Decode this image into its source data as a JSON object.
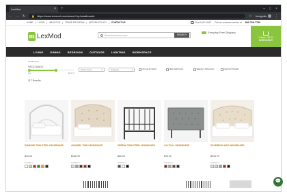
{
  "browser": {
    "tab_title": "LexMod",
    "url": "https://www.lexmod.com/search?q=headboards",
    "incognito_label": "Incognito"
  },
  "topstrip": {
    "links": [
      "HOME",
      "LOGIN",
      "ABOUT US",
      "TRADE PROGRAM",
      "RETURN POLICY",
      "CONTACT US"
    ],
    "chat_label": "Chat LIVE CHAT",
    "call_label": "Call our customer service at",
    "phone": "800-768-7750"
  },
  "header": {
    "logo_letter": "m",
    "logo_text": "LexMod",
    "search_placeholder": "Search lexmod.com",
    "search_button": "SEARCH",
    "promo": "Everyday Free Shipping",
    "checkout_items": "0 items - $0.00",
    "checkout_label": "CHECKOUT"
  },
  "nav": [
    "LIVING",
    "DINING",
    "BEDROOM",
    "OUTDOOR",
    "LIGHTING",
    "WORKSPACE"
  ],
  "breadcrumb": "headboards",
  "filters": {
    "price_label": "PRICE RANGE:",
    "price_min": "$40",
    "price_max": "$224.70",
    "price_fill_fraction": 0.6,
    "select_color": "Select Color",
    "select_category": "Category",
    "checkboxes": [
      "ON SALE ITEMS",
      "NEW ARRIVALS",
      "WEEKLY SPECIALS",
      "DISCONTINUED"
    ]
  },
  "results_count": "117 Results",
  "products": [
    {
      "name": "DIAMOND TWIN STEEL HEADBOARD",
      "price": "$40.00",
      "avail": "Available in",
      "swatches": [
        "#ffffff",
        "#d9c8a0",
        "#c62828",
        "#2e7d32",
        "#f9a825",
        "#222222"
      ]
    },
    {
      "name": "ANNABEL TWIN HEADBOARD",
      "price": "$155.79",
      "avail": "Available in",
      "swatches": [
        "#e8dcc4",
        "#9e9e9e",
        "#3e2723",
        "#b71c1c",
        "#111111"
      ]
    },
    {
      "name": "SERENA TWIN STEEL HEADBOARD",
      "price": "$60.00",
      "avail": "Available in",
      "swatches": [
        "#5d4037",
        "#ffffff",
        "#000000"
      ]
    },
    {
      "name": "LILY FULL HEADBOARD",
      "price": "$76.20",
      "avail": "Available in",
      "swatches": [
        "#8d1c1c",
        "#9e9e9e",
        "#5d4037",
        "#222222"
      ]
    },
    {
      "name": "SOVEREIGN KING HEADBOARD",
      "price": "$224.70",
      "avail": "Available in",
      "swatches": [
        "#e8dcc4",
        "#d7ccc8",
        "#9e9e9e",
        "#b71c1c",
        "#111111"
      ]
    }
  ],
  "colors": {
    "brand_green": "#8bc53f",
    "nav_bg": "#2b2b2b",
    "product_name": "#c07a00"
  }
}
